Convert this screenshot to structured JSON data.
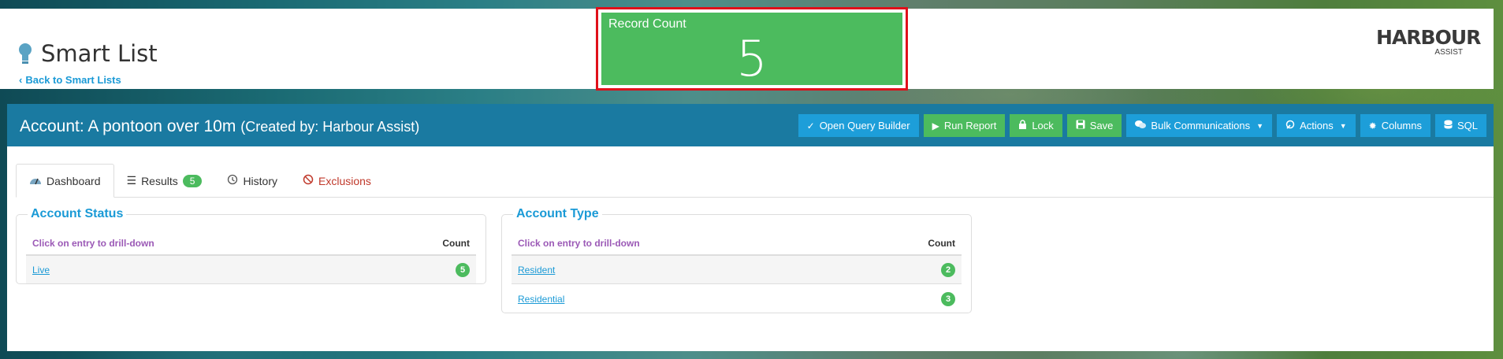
{
  "header": {
    "title": "Smart List",
    "back_link": "Back to Smart Lists",
    "logo_main": "HARBOUR",
    "logo_sub": "ASSIST"
  },
  "record_count": {
    "label": "Record Count",
    "value": "5"
  },
  "panel": {
    "title": "Account: A pontoon over 10m",
    "created_by": "(Created by: Harbour Assist)"
  },
  "toolbar": [
    {
      "label": "Open Query Builder",
      "icon": "check-icon",
      "color": "blue",
      "caret": false
    },
    {
      "label": "Run Report",
      "icon": "play-icon",
      "color": "green",
      "caret": false
    },
    {
      "label": "Lock",
      "icon": "lock-icon",
      "color": "green",
      "caret": false
    },
    {
      "label": "Save",
      "icon": "save-icon",
      "color": "green",
      "caret": false
    },
    {
      "label": "Bulk Communications",
      "icon": "chat-icon",
      "color": "blue",
      "caret": true
    },
    {
      "label": "Actions",
      "icon": "wrench-icon",
      "color": "blue",
      "caret": true
    },
    {
      "label": "Columns",
      "icon": "gear-icon",
      "color": "blue",
      "caret": false
    },
    {
      "label": "SQL",
      "icon": "database-icon",
      "color": "blue",
      "caret": false
    }
  ],
  "tabs": [
    {
      "label": "Dashboard",
      "icon": "dashboard-icon",
      "active": true
    },
    {
      "label": "Results",
      "icon": "list-icon",
      "badge": "5"
    },
    {
      "label": "History",
      "icon": "history-icon"
    },
    {
      "label": "Exclusions",
      "icon": "ban-icon"
    }
  ],
  "account_status": {
    "title": "Account Status",
    "hint": "Click on entry to drill-down",
    "count_header": "Count",
    "rows": [
      {
        "label": "Live",
        "count": "5"
      }
    ]
  },
  "account_type": {
    "title": "Account Type",
    "hint": "Click on entry to drill-down",
    "count_header": "Count",
    "rows": [
      {
        "label": "Resident",
        "count": "2"
      },
      {
        "label": "Residential",
        "count": "3"
      }
    ]
  },
  "colors": {
    "accent_blue": "#1d9ed9",
    "accent_green": "#4cbb5e",
    "header_bar": "#1a7aa1",
    "highlight_border": "#e0101a"
  }
}
